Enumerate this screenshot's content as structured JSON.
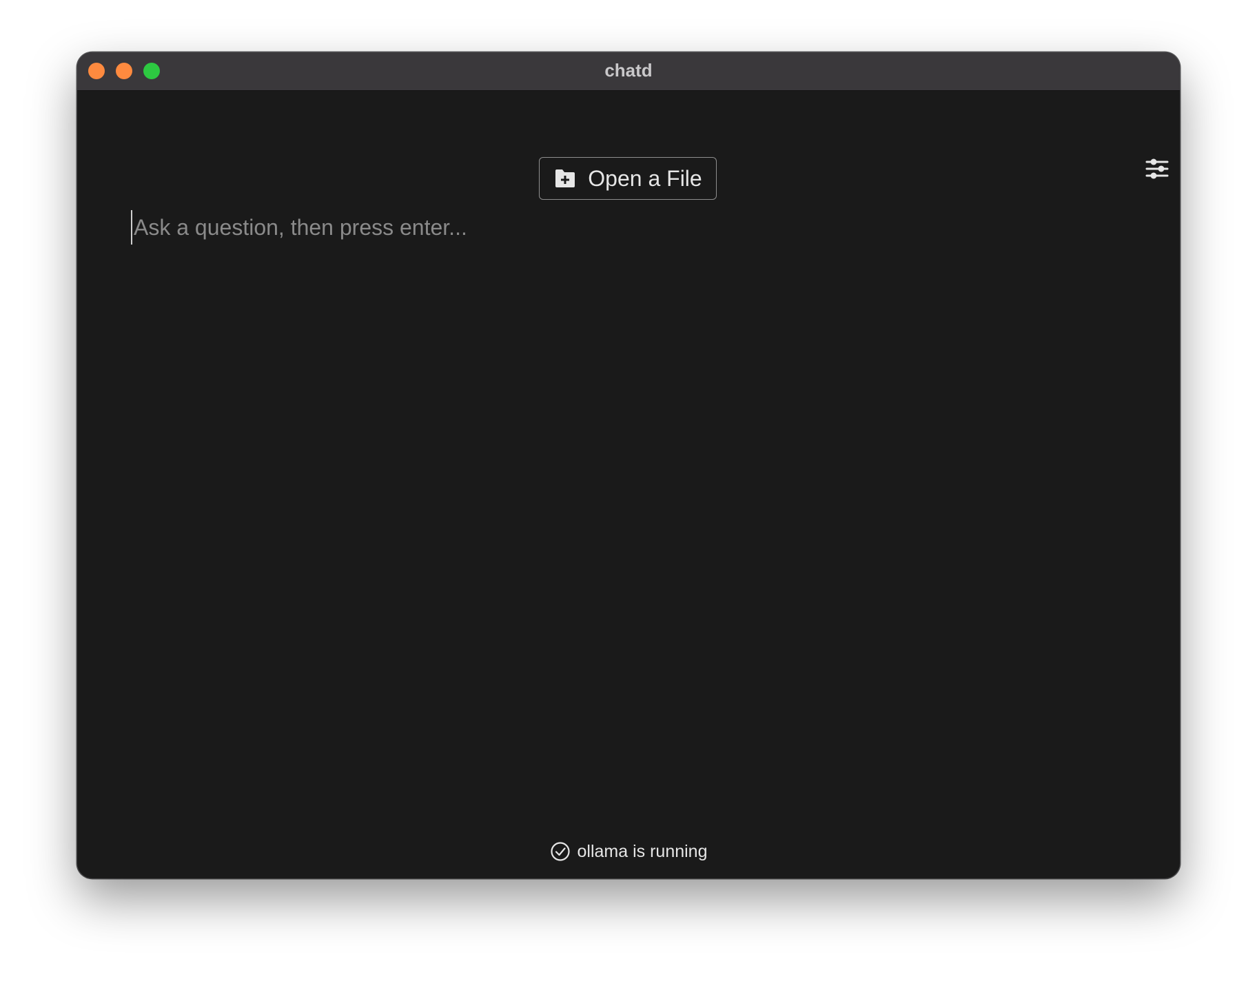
{
  "window": {
    "title": "chatd",
    "traffic_lights": [
      {
        "name": "close",
        "color": "#fe8a3f"
      },
      {
        "name": "minimize",
        "color": "#fe8a3f"
      },
      {
        "name": "maximize",
        "color": "#2dc841"
      }
    ]
  },
  "toolbar": {
    "open_file_label": "Open a File",
    "open_file_icon": "folder-plus-icon",
    "settings_icon": "sliders-icon"
  },
  "question": {
    "placeholder": "Ask a question, then press enter...",
    "value": ""
  },
  "status": {
    "label": "ollama is running",
    "icon": "check-circle-icon"
  },
  "colors": {
    "window_bg": "#1a1a1a",
    "titlebar_bg": "#3a383b",
    "text": "#e6e6e6",
    "placeholder": "#8a8a8a",
    "border": "#8f8f8f"
  }
}
